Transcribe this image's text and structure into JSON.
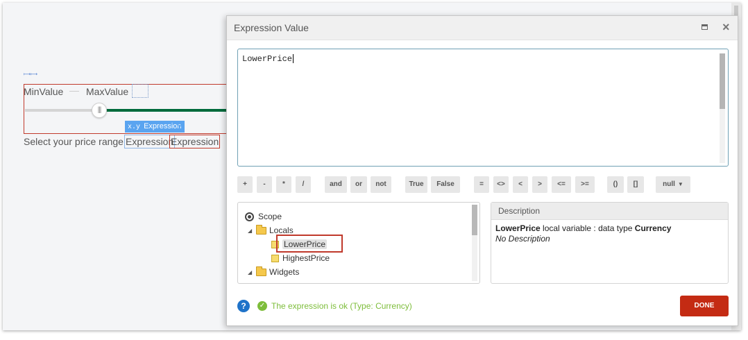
{
  "canvas": {
    "min_label": "MinValue",
    "max_label": "MaxValue",
    "slider_handle_glyph": "|||",
    "expression_tag": {
      "prefix": "x.y",
      "label": "Expression",
      "tail": "y"
    },
    "range_label": "Select your price range",
    "expression_1": "Expression",
    "expression_2": "Expression"
  },
  "dialog": {
    "title": "Expression Value",
    "editor_value": "LowerPrice",
    "operators": [
      {
        "label": "+"
      },
      {
        "label": "-"
      },
      {
        "label": "*"
      },
      {
        "label": "/"
      },
      {
        "label": "and"
      },
      {
        "label": "or"
      },
      {
        "label": "not"
      },
      {
        "label": "True"
      },
      {
        "label": "False"
      },
      {
        "label": "="
      },
      {
        "label": "<>"
      },
      {
        "label": "<"
      },
      {
        "label": ">"
      },
      {
        "label": "<="
      },
      {
        "label": ">="
      },
      {
        "label": "()"
      },
      {
        "label": "[]"
      },
      {
        "label": "null"
      }
    ],
    "tree": {
      "scope": "Scope",
      "locals": "Locals",
      "items": [
        "LowerPrice",
        "HighestPrice"
      ],
      "widgets": "Widgets"
    },
    "description": {
      "title": "Description",
      "name": "LowerPrice",
      "middle": " local variable : data type ",
      "type": "Currency",
      "note": "No Description"
    },
    "help_glyph": "?",
    "status": "The expression is ok (Type: Currency)",
    "done_label": "DONE"
  },
  "colors": {
    "accent_red": "#c42b13",
    "ok_green": "#7dbd3a",
    "help_blue": "#1f73c9",
    "slider_green": "#006b3c",
    "tag_blue": "#5aa4f0"
  }
}
